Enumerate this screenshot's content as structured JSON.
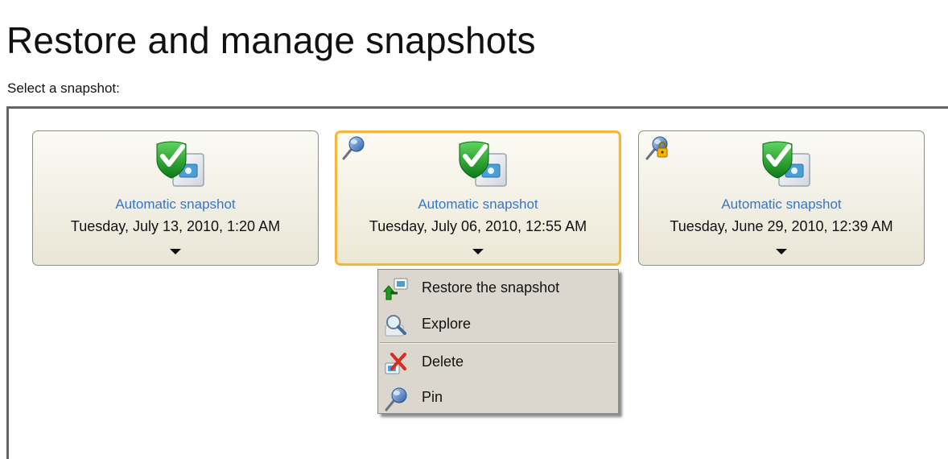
{
  "page": {
    "title": "Restore and manage snapshots",
    "subtitle": "Select a snapshot:"
  },
  "snapshots": [
    {
      "label": "Automatic snapshot",
      "date": "Tuesday, July 13, 2010, 1:20 AM",
      "selected": false,
      "badge": null
    },
    {
      "label": "Automatic snapshot",
      "date": "Tuesday, July 06, 2010, 12:55 AM",
      "selected": true,
      "badge": "pin-icon"
    },
    {
      "label": "Automatic snapshot",
      "date": "Tuesday, June 29, 2010, 12:39 AM",
      "selected": false,
      "badge": "pin-locked-icon"
    }
  ],
  "context_menu": {
    "items": [
      {
        "label": "Restore the snapshot",
        "icon": "restore-icon"
      },
      {
        "label": "Explore",
        "icon": "magnifier-icon"
      },
      {
        "label": "Delete",
        "icon": "delete-icon"
      },
      {
        "label": "Pin",
        "icon": "pin-icon"
      }
    ]
  },
  "colors": {
    "card_label": "#3b75c2",
    "selected_border": "#f4b73d",
    "menu_background": "#dbd7cf",
    "check_green": "#1ea01e"
  }
}
